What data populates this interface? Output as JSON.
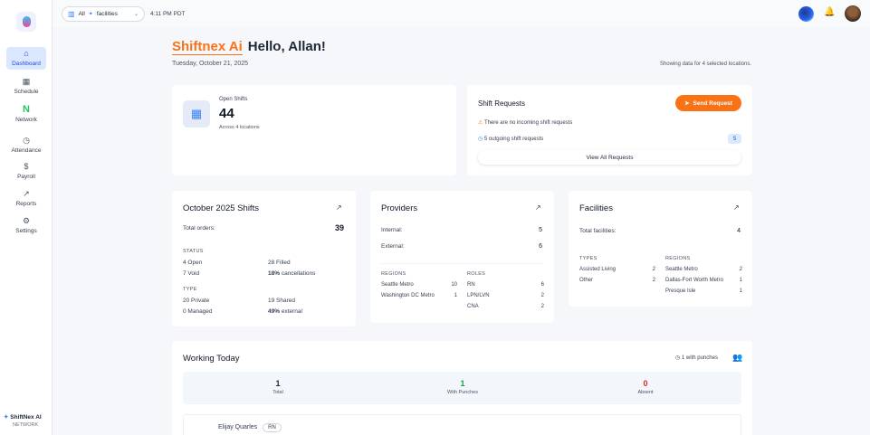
{
  "sidebar": {
    "items": [
      {
        "label": "Dashboard",
        "icon": "home-icon",
        "glyph": "⌂"
      },
      {
        "label": "Schedule",
        "icon": "calendar-icon",
        "glyph": "▦"
      },
      {
        "label": "Network",
        "icon": "network-logo-icon",
        "glyph": "N"
      },
      {
        "label": "Attendance",
        "icon": "clock-icon",
        "glyph": "◷"
      },
      {
        "label": "Payroll",
        "icon": "dollar-icon",
        "glyph": "$"
      },
      {
        "label": "Reports",
        "icon": "chart-icon",
        "glyph": "↗"
      },
      {
        "label": "Settings",
        "icon": "gear-icon",
        "glyph": "⚙"
      }
    ],
    "brand": "ShiftNex AI",
    "brand_sub": "NETWORK"
  },
  "topbar": {
    "facility_prefix": "All",
    "facility_label": "facilities",
    "time": "4:11 PM PDT"
  },
  "header": {
    "brand": "Shiftnex Ai",
    "greeting": "Hello, Allan!",
    "date": "Tuesday, October 21, 2025",
    "showing": "Showing data for 4 selected locations."
  },
  "open_shifts": {
    "label": "Open Shifts",
    "count": "44",
    "sub": "Across 4 locations"
  },
  "shift_requests": {
    "title": "Shift Requests",
    "send_label": "Send Request",
    "incoming": "There are no incoming shift requests",
    "outgoing": "5 outgoing shift requests",
    "outgoing_count": "5",
    "view_all": "View All Requests"
  },
  "shifts_card": {
    "title": "October 2025 Shifts",
    "total_label": "Total orders:",
    "total": "39",
    "status_cap": "STATUS",
    "open": "4 Open",
    "filled": "28 Filled",
    "void": "7 Void",
    "cancel_pct": "18%",
    "cancel_label": "cancellations",
    "type_cap": "TYPE",
    "private": "20 Private",
    "shared": "19 Shared",
    "managed": "0 Managed",
    "external_pct": "49%",
    "external_label": "external"
  },
  "providers_card": {
    "title": "Providers",
    "internal_label": "Internal:",
    "internal": "5",
    "external_label": "External:",
    "external": "6",
    "regions_cap": "REGIONS",
    "regions": [
      {
        "name": "Seattle Metro",
        "count": "10"
      },
      {
        "name": "Washington DC Metro",
        "count": "1"
      }
    ],
    "roles_cap": "ROLES",
    "roles": [
      {
        "name": "RN",
        "count": "6"
      },
      {
        "name": "LPN/LVN",
        "count": "2"
      },
      {
        "name": "CNA",
        "count": "2"
      }
    ]
  },
  "facilities_card": {
    "title": "Facilities",
    "total_label": "Total facilities:",
    "total": "4",
    "types_cap": "TYPES",
    "types": [
      {
        "name": "Assisted Living",
        "count": "2"
      },
      {
        "name": "Other",
        "count": "2"
      }
    ],
    "regions_cap": "REGIONS",
    "regions": [
      {
        "name": "Seattle Metro",
        "count": "2"
      },
      {
        "name": "Dallas-Fort Worth Metro",
        "count": "1"
      },
      {
        "name": "Presque Isle",
        "count": "1"
      }
    ]
  },
  "working_today": {
    "title": "Working Today",
    "punches_label": "1 with punches",
    "total": "1",
    "total_label": "Total",
    "with_punches": "1",
    "with_punches_label": "With Punches",
    "absent": "0",
    "absent_label": "Absent",
    "worker_name": "Elijay Quarles",
    "worker_role": "RN"
  },
  "colors": {
    "accent": "#f97316",
    "primary": "#1d4ed8",
    "success": "#16a34a",
    "danger": "#dc2626"
  }
}
